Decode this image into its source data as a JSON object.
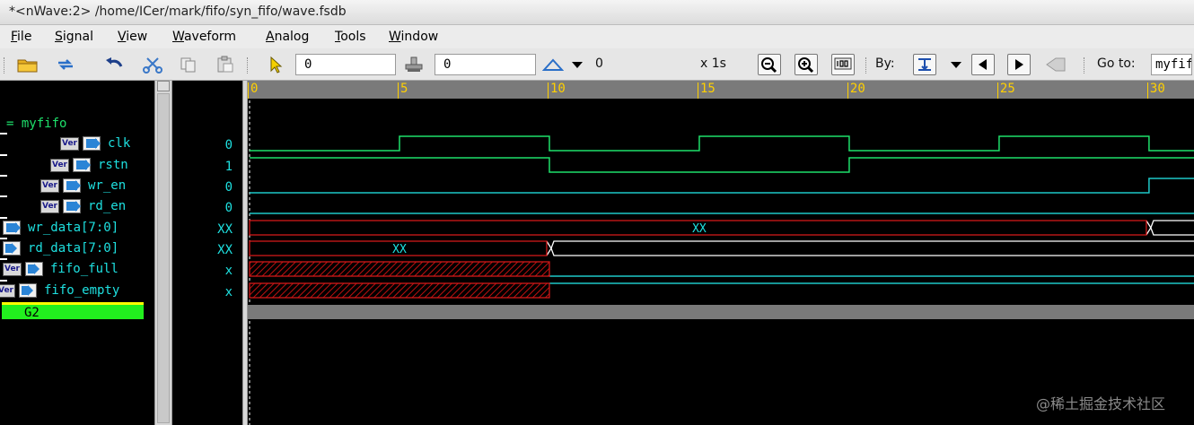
{
  "window": {
    "title": "*<nWave:2> /home/ICer/mark/fifo/syn_fifo/wave.fsdb"
  },
  "menu": [
    {
      "mn": "F",
      "rest": "ile"
    },
    {
      "mn": "S",
      "rest": "ignal"
    },
    {
      "mn": "V",
      "rest": "iew"
    },
    {
      "mn": "W",
      "rest": "aveform"
    },
    {
      "mn": "A",
      "rest": "nalog"
    },
    {
      "mn": "T",
      "rest": "ools"
    },
    {
      "mn": "W",
      "rest": "indow"
    }
  ],
  "toolbar": {
    "cursor_time": "0",
    "marker_time": "0",
    "delta_time": "0",
    "zoom_label": "x 1s",
    "by_label": "By:",
    "goto_label": "Go to:",
    "goto_value": "myfifo"
  },
  "colors": {
    "clk": "#1ee06b",
    "rstn": "#1ee06b",
    "wr_en": "#1ec8c8",
    "rd_en": "#1ec8c8",
    "bus_unknown": "#d01818",
    "bus_valid": "#ffffff",
    "fill_unknown": "#a01010"
  },
  "group": {
    "name": "= myfifo"
  },
  "signals": [
    {
      "name": "clk",
      "value": "0",
      "icon": "input-port-icon",
      "tag": "Ver"
    },
    {
      "name": "rstn",
      "value": "1",
      "icon": "input-port-icon",
      "tag": "Ver"
    },
    {
      "name": "wr_en",
      "value": "0",
      "icon": "input-port-icon",
      "tag": "Ver"
    },
    {
      "name": "rd_en",
      "value": "0",
      "icon": "input-port-icon",
      "tag": "Ver"
    },
    {
      "name": "wr_data[7:0]",
      "value": "XX",
      "icon": "input-port-icon",
      "tag": ""
    },
    {
      "name": "rd_data[7:0]",
      "value": "XX",
      "icon": "output-port-icon",
      "tag": ""
    },
    {
      "name": "fifo_full",
      "value": "x",
      "icon": "output-port-icon",
      "tag": "Ver"
    },
    {
      "name": "fifo_empty",
      "value": "x",
      "icon": "output-port-icon",
      "tag": "Ver"
    }
  ],
  "group2": {
    "name": "G2"
  },
  "ruler": {
    "labels": [
      "0",
      "5",
      "10",
      "15",
      "20",
      "25",
      "30"
    ],
    "step": 5,
    "range": [
      0,
      31.5
    ]
  },
  "bus_labels": {
    "wr_data": "XX",
    "rd_data": "XX"
  },
  "waveforms": {
    "clk": [
      [
        0,
        0
      ],
      [
        5,
        1
      ],
      [
        10,
        0
      ],
      [
        15,
        1
      ],
      [
        20,
        0
      ],
      [
        25,
        1
      ],
      [
        30,
        0
      ]
    ],
    "rstn": [
      [
        0,
        1
      ],
      [
        10,
        0
      ],
      [
        20,
        1
      ]
    ],
    "wr_en": [
      [
        0,
        0
      ],
      [
        30,
        1
      ]
    ],
    "rd_en": [
      [
        0,
        0
      ]
    ],
    "wr_data_unknown_end": 30,
    "rd_data_unknown_end": 10,
    "fifo_full_unknown_end": 10,
    "fifo_full_after": 0,
    "fifo_empty_unknown_end": 10,
    "fifo_empty_after": 1
  },
  "watermark": "@稀土掘金技术社区"
}
